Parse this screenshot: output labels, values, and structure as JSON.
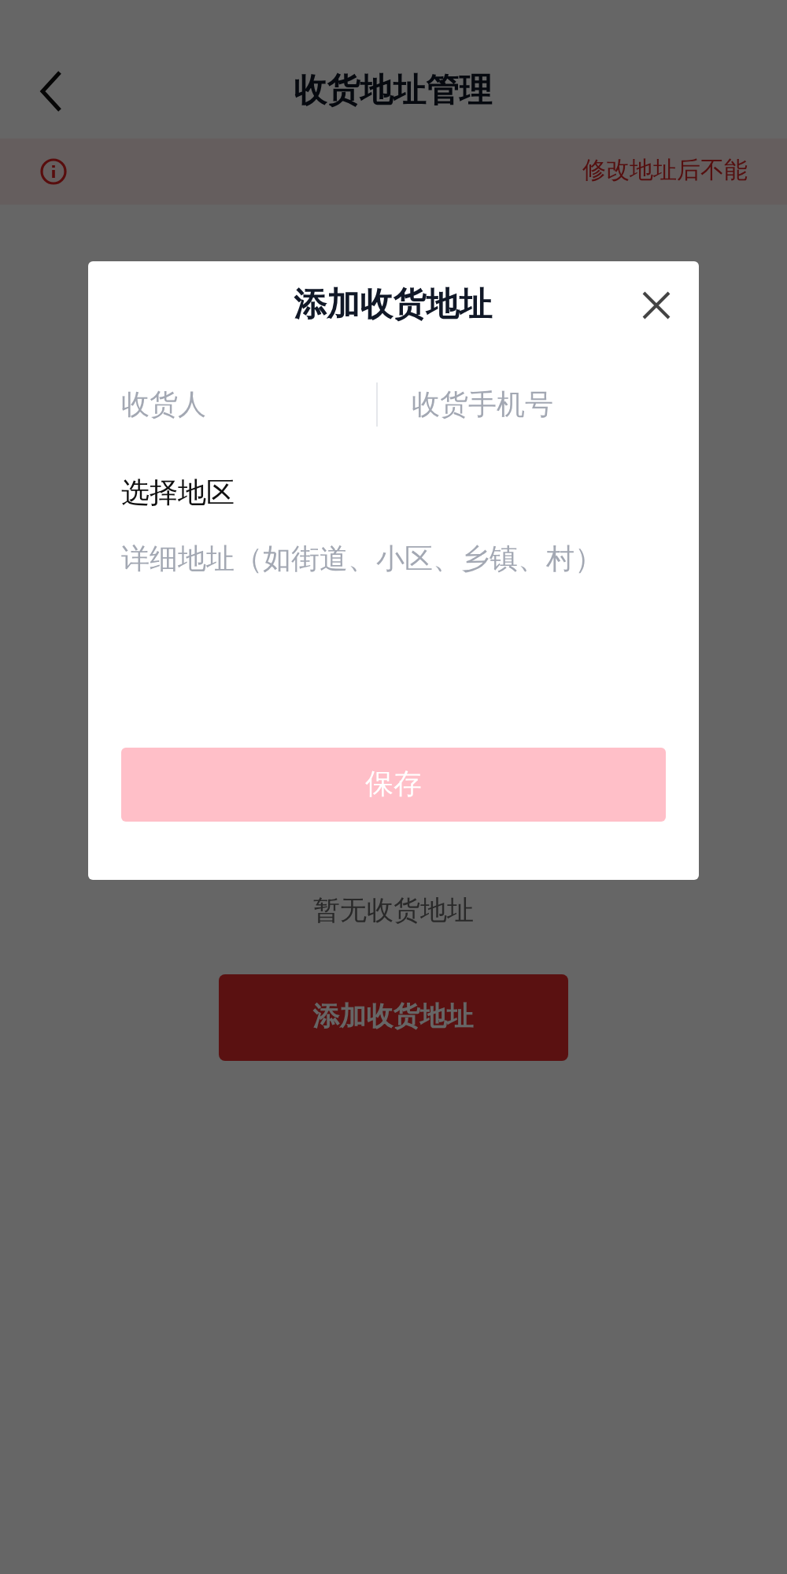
{
  "header": {
    "title": "收货地址管理"
  },
  "notice": {
    "text": "修改地址后不能"
  },
  "empty_state": {
    "text": "暂无收货地址"
  },
  "add_button": {
    "label": "添加收货地址"
  },
  "dialog": {
    "title": "添加收货地址",
    "fields": [
      {
        "placeholder": "收货人"
      },
      {
        "placeholder": "收货手机号"
      }
    ],
    "region_field": {
      "label": "选择地区"
    },
    "detail_field": {
      "placeholder": "详细地址（如街道、小区、乡镇、村）"
    },
    "save_button": {
      "label": "保存",
      "disabled": true
    }
  }
}
